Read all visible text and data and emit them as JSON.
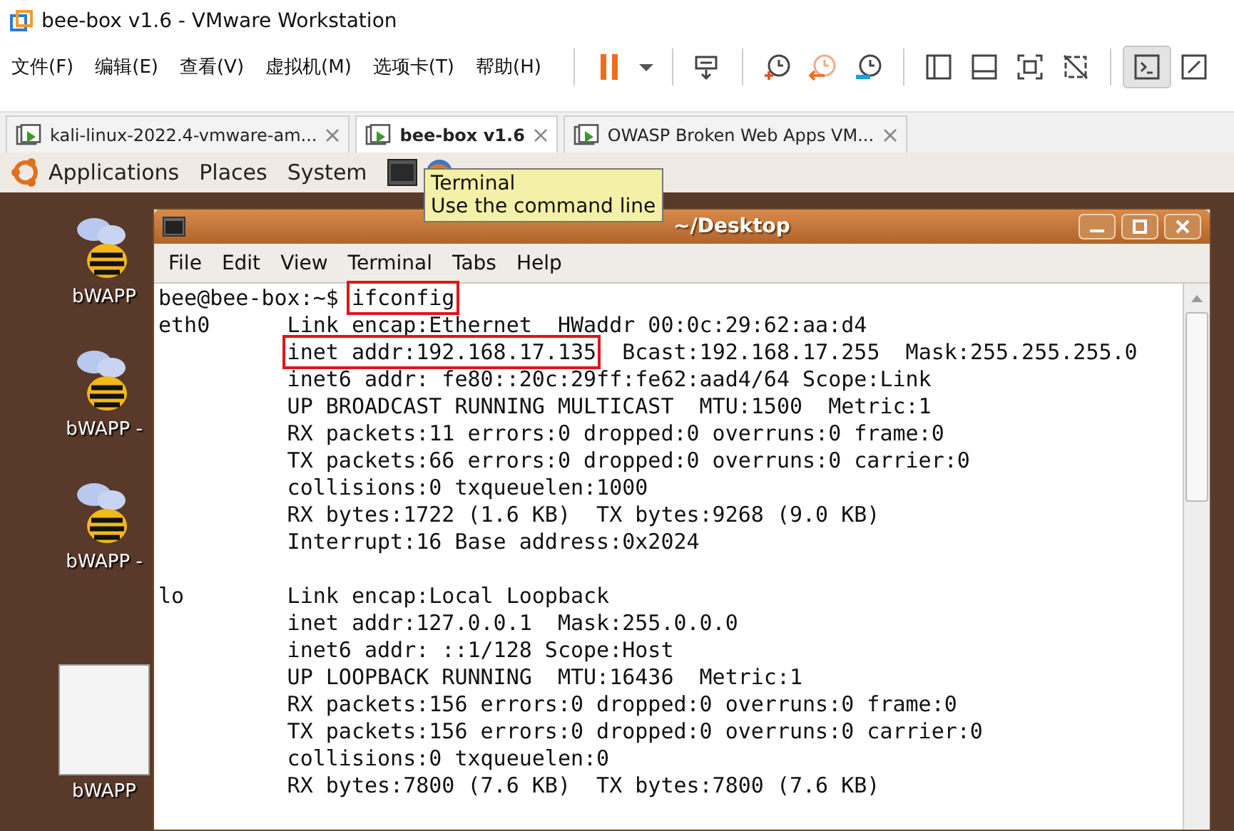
{
  "window": {
    "title": "bee-box v1.6 - VMware Workstation"
  },
  "menu": [
    "文件(F)",
    "编辑(E)",
    "查看(V)",
    "虚拟机(M)",
    "选项卡(T)",
    "帮助(H)"
  ],
  "toolbar_buttons": [
    {
      "selected": false
    },
    {
      "selected": false
    },
    {
      "selected": false
    },
    {
      "selected": false
    },
    {
      "selected": false
    },
    {
      "selected": false
    },
    {
      "selected": false
    },
    {
      "selected": false
    },
    {
      "selected": false
    },
    {
      "selected": false
    },
    {
      "selected": true
    },
    {
      "selected": false
    }
  ],
  "tabs": [
    {
      "label": "kali-linux-2022.4-vmware-am...",
      "selected": false
    },
    {
      "label": "bee-box v1.6",
      "selected": true
    },
    {
      "label": "OWASP Broken Web Apps VM...",
      "selected": false
    }
  ],
  "gnome_panel": {
    "menus": [
      "Applications",
      "Places",
      "System"
    ]
  },
  "desktop_icons": [
    {
      "kind": "bee",
      "label": "bWAPP"
    },
    {
      "kind": "bee",
      "label": "bWAPP -"
    },
    {
      "kind": "bee",
      "label": "bWAPP -"
    },
    {
      "kind": "document",
      "label": "bWAPP"
    }
  ],
  "tooltip": {
    "title": "Terminal",
    "text": "Use the command line"
  },
  "terminal": {
    "title": "~/Desktop",
    "menu": [
      "File",
      "Edit",
      "View",
      "Terminal",
      "Tabs",
      "Help"
    ],
    "lines": [
      {
        "kind": "prompt",
        "segments": [
          {
            "text": "bee@bee-box:~$ ",
            "boxed": false
          },
          {
            "text": "ifconfig",
            "boxed": true
          }
        ]
      },
      {
        "kind": "output",
        "label": "eth0",
        "segments": [
          {
            "text": "Link encap:Ethernet  HWaddr 00:0c:29:62:aa:d4",
            "boxed": false
          }
        ]
      },
      {
        "kind": "output",
        "segments": [
          {
            "text": "inet addr:192.168.17.135",
            "boxed": true
          },
          {
            "text": "  Bcast:192.168.17.255  Mask:255.255.255.0",
            "boxed": false
          }
        ]
      },
      {
        "kind": "output",
        "segments": [
          {
            "text": "inet6 addr: fe80::20c:29ff:fe62:aad4/64 Scope:Link",
            "boxed": false
          }
        ]
      },
      {
        "kind": "output",
        "segments": [
          {
            "text": "UP BROADCAST RUNNING MULTICAST  MTU:1500  Metric:1",
            "boxed": false
          }
        ]
      },
      {
        "kind": "output",
        "segments": [
          {
            "text": "RX packets:11 errors:0 dropped:0 overruns:0 frame:0",
            "boxed": false
          }
        ]
      },
      {
        "kind": "output",
        "segments": [
          {
            "text": "TX packets:66 errors:0 dropped:0 overruns:0 carrier:0",
            "boxed": false
          }
        ]
      },
      {
        "kind": "output",
        "segments": [
          {
            "text": "collisions:0 txqueuelen:1000",
            "boxed": false
          }
        ]
      },
      {
        "kind": "output",
        "segments": [
          {
            "text": "RX bytes:1722 (1.6 KB)  TX bytes:9268 (9.0 KB)",
            "boxed": false
          }
        ]
      },
      {
        "kind": "output",
        "segments": [
          {
            "text": "Interrupt:16 Base address:0x2024",
            "boxed": false
          }
        ]
      },
      {
        "kind": "blank"
      },
      {
        "kind": "output",
        "label": "lo",
        "segments": [
          {
            "text": "Link encap:Local Loopback",
            "boxed": false
          }
        ]
      },
      {
        "kind": "output",
        "segments": [
          {
            "text": "inet addr:127.0.0.1  Mask:255.0.0.0",
            "boxed": false
          }
        ]
      },
      {
        "kind": "output",
        "segments": [
          {
            "text": "inet6 addr: ::1/128 Scope:Host",
            "boxed": false
          }
        ]
      },
      {
        "kind": "output",
        "segments": [
          {
            "text": "UP LOOPBACK RUNNING  MTU:16436  Metric:1",
            "boxed": false
          }
        ]
      },
      {
        "kind": "output",
        "segments": [
          {
            "text": "RX packets:156 errors:0 dropped:0 overruns:0 frame:0",
            "boxed": false
          }
        ]
      },
      {
        "kind": "output",
        "segments": [
          {
            "text": "TX packets:156 errors:0 dropped:0 overruns:0 carrier:0",
            "boxed": false
          }
        ]
      },
      {
        "kind": "output",
        "segments": [
          {
            "text": "collisions:0 txqueuelen:0",
            "boxed": false
          }
        ]
      },
      {
        "kind": "output",
        "segments": [
          {
            "text": "RX bytes:7800 (7.6 KB)  TX bytes:7800 (7.6 KB)",
            "boxed": false
          }
        ]
      }
    ]
  }
}
